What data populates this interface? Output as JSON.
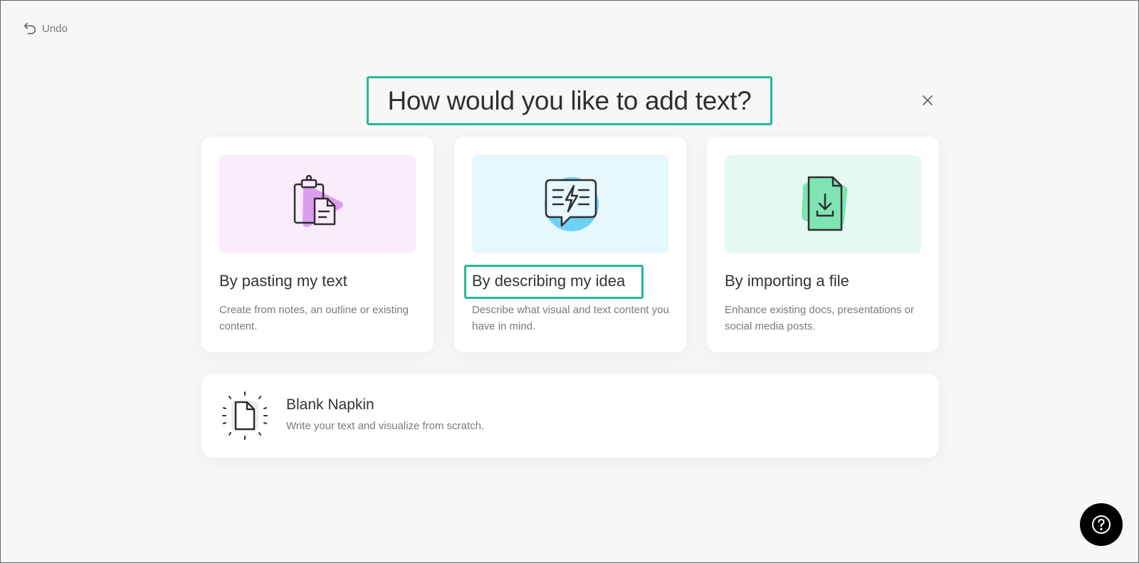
{
  "toolbar": {
    "undo_label": "Undo"
  },
  "dialog": {
    "title": "How would you like to add text?",
    "options": [
      {
        "title": "By pasting my text",
        "description": "Create from notes, an outline or existing content.",
        "bg_color": "#fbecfd",
        "accent_color": "#dc9ef0",
        "icon": "clipboard-paste-icon"
      },
      {
        "title": "By describing my idea",
        "description": "Describe what visual and text content you have in mind.",
        "bg_color": "#e6f7fd",
        "accent_color": "#6fd0f5",
        "icon": "lightning-chat-icon"
      },
      {
        "title": "By importing a file",
        "description": "Enhance existing docs, presentations or social media posts.",
        "bg_color": "#e6f9f1",
        "accent_color": "#7fe4b2",
        "icon": "file-download-icon"
      }
    ],
    "blank": {
      "title": "Blank Napkin",
      "description": "Write your text and visualize from scratch.",
      "icon": "blank-page-icon"
    }
  },
  "help": {
    "icon": "question-icon"
  },
  "colors": {
    "highlight": "#23b89b"
  }
}
